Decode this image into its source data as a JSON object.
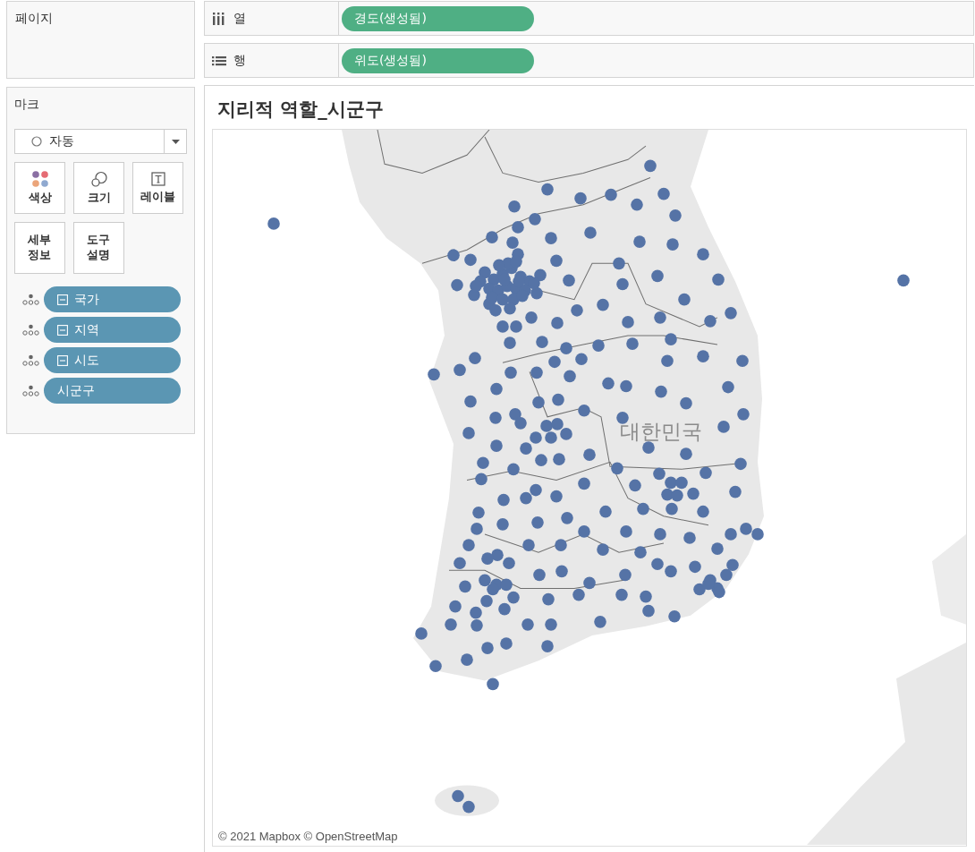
{
  "pages_shelf": {
    "title": "페이지"
  },
  "columns_shelf": {
    "label": "열",
    "pill": "경도(생성됨)"
  },
  "rows_shelf": {
    "label": "행",
    "pill": "위도(생성됨)"
  },
  "marks": {
    "title": "마크",
    "mark_type": "자동",
    "buttons": [
      {
        "label": "색상",
        "kind": "color"
      },
      {
        "label": "크기",
        "kind": "size"
      },
      {
        "label": "레이블",
        "kind": "label"
      },
      {
        "label": "세부 정보",
        "kind": "detail"
      },
      {
        "label": "도구 설명",
        "kind": "tooltip"
      }
    ],
    "fields": [
      {
        "label": "국가",
        "hierarchy": true
      },
      {
        "label": "지역",
        "hierarchy": true
      },
      {
        "label": "시도",
        "hierarchy": true
      },
      {
        "label": "시군구",
        "hierarchy": false
      }
    ]
  },
  "view": {
    "title": "지리적 역할_시군구",
    "map_label": "대한민국",
    "attribution": "© 2021 Mapbox © OpenStreetMap"
  }
}
